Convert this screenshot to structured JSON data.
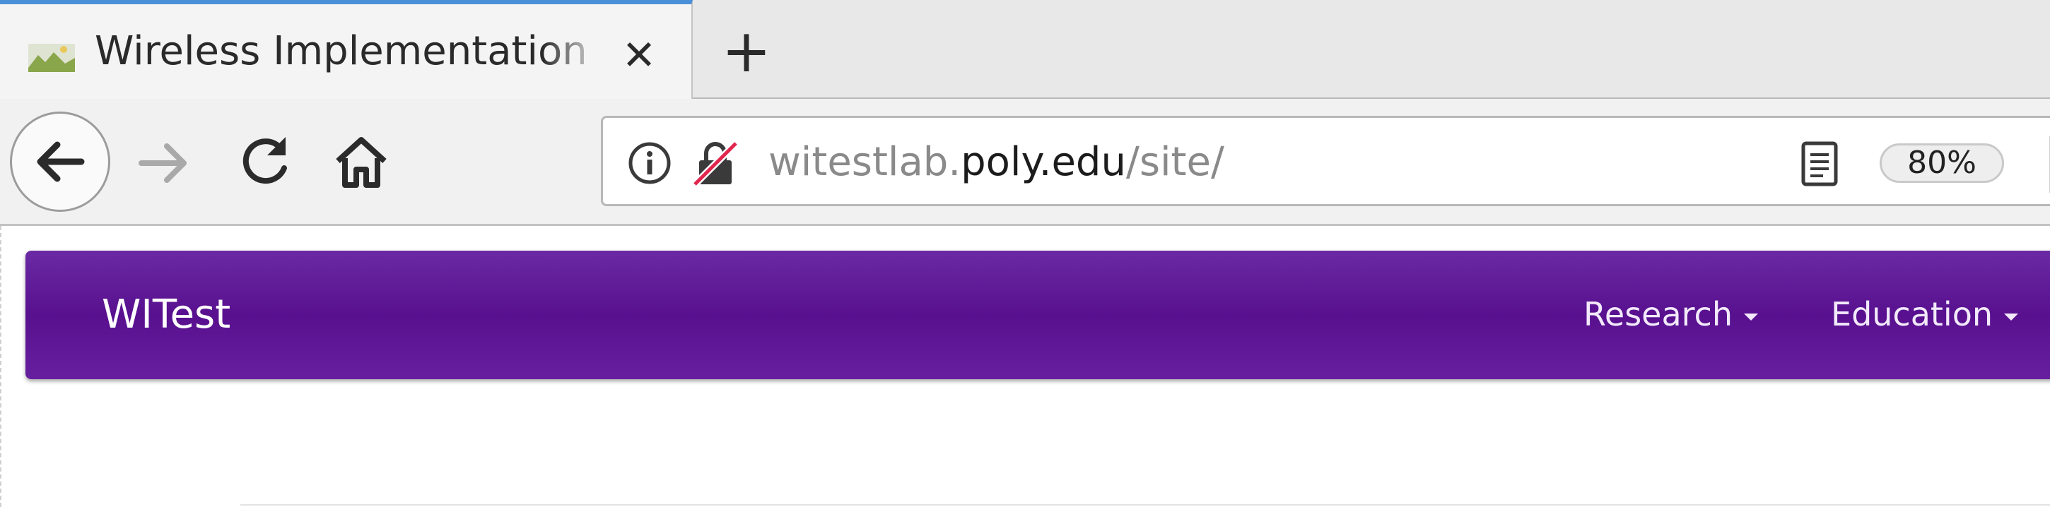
{
  "browser": {
    "tab": {
      "title": "Wireless Implementation",
      "favicon": "landscape-favicon-icon",
      "close_icon": "close-icon"
    },
    "new_tab_icon": "plus-icon",
    "toolbar": {
      "back_icon": "back-arrow-icon",
      "forward_icon": "forward-arrow-icon",
      "reload_icon": "reload-icon",
      "home_icon": "home-icon"
    },
    "urlbar": {
      "info_icon": "info-icon",
      "lock_icon": "insecure-lock-icon",
      "url_prefix": "witestlab.",
      "url_domain": "poly.edu",
      "url_path": "/site/",
      "reader_icon": "reader-view-icon",
      "zoom": "80%"
    }
  },
  "site": {
    "brand": "WITest",
    "nav": [
      {
        "label": "Research"
      },
      {
        "label": "Education"
      }
    ]
  },
  "colors": {
    "navbar": "#58108f",
    "tab_accent": "#4a90d9",
    "lock_slash": "#e2264d"
  }
}
